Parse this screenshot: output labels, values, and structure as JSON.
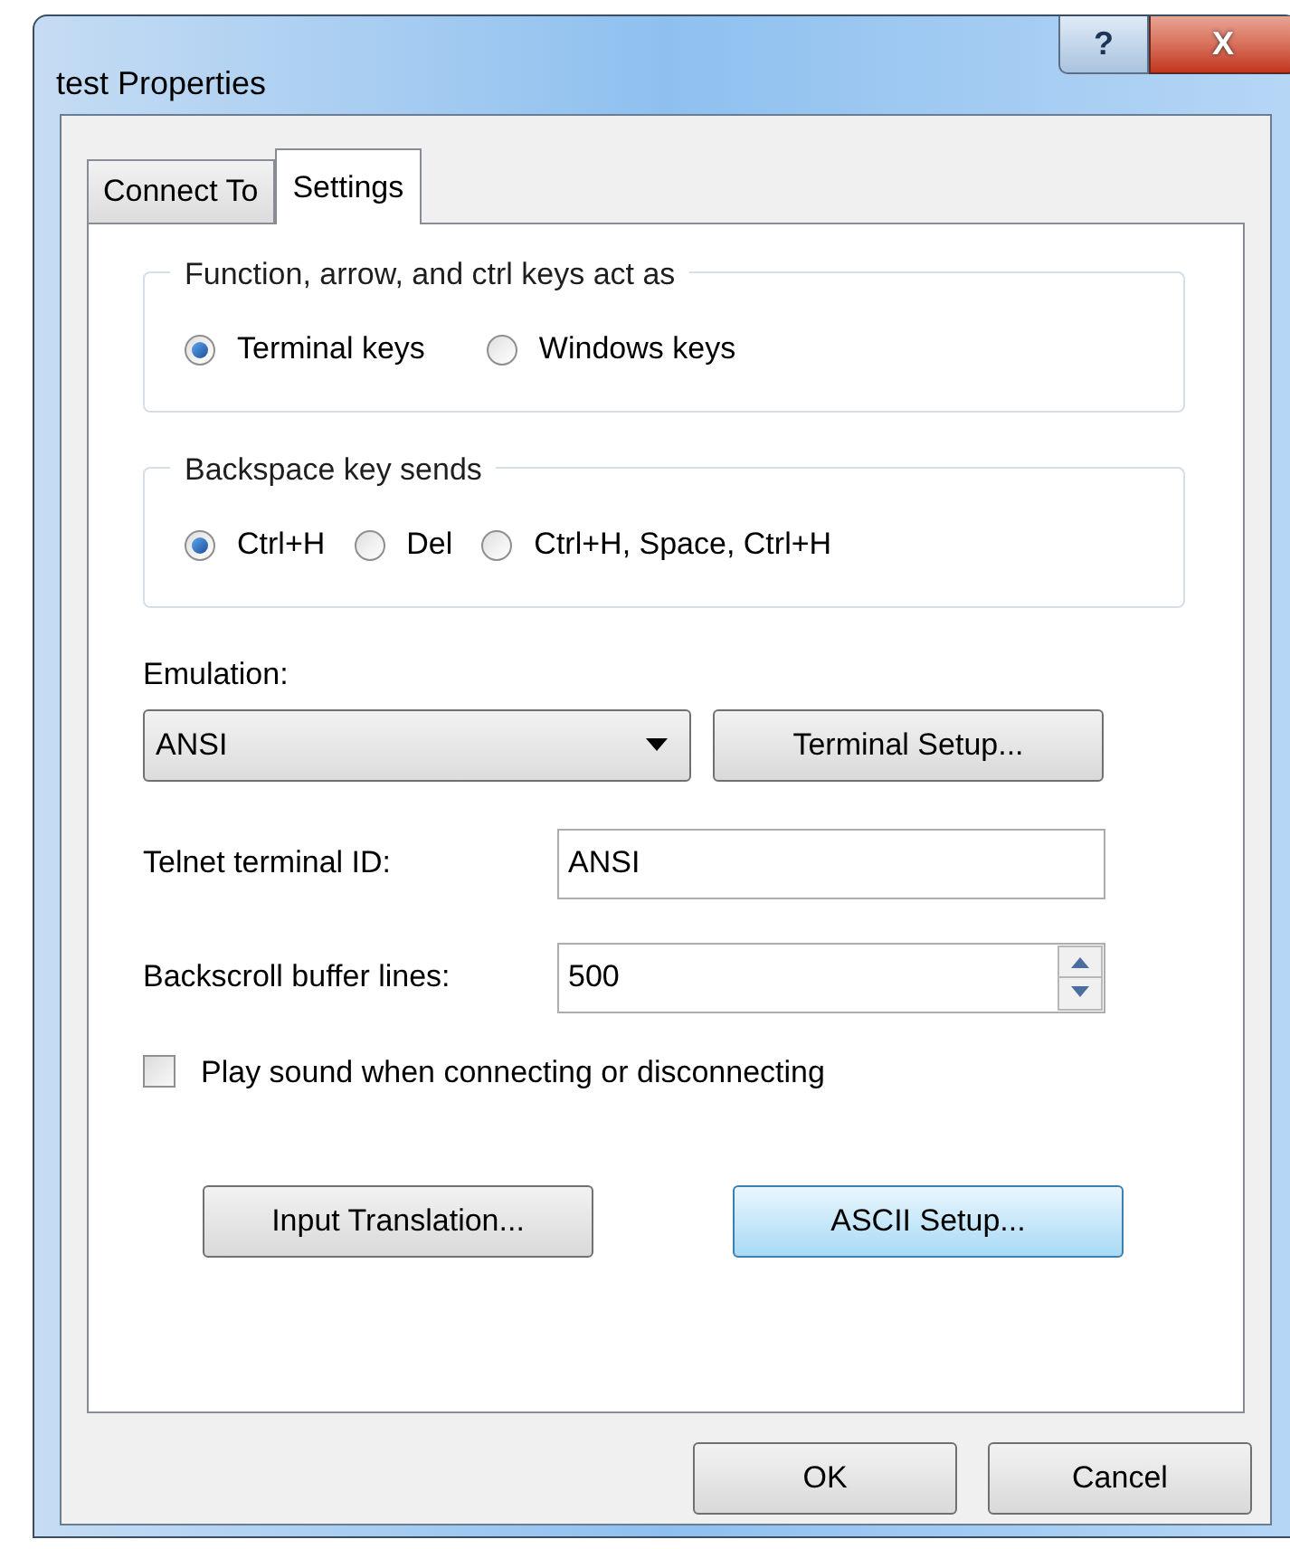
{
  "window": {
    "title": "test Properties",
    "help_button": "?",
    "close_button": "X"
  },
  "tabs": [
    {
      "label": "Connect To",
      "selected": false
    },
    {
      "label": "Settings",
      "selected": true
    }
  ],
  "groups": [
    {
      "legend": "Function, arrow, and ctrl keys act as",
      "options": [
        {
          "label": "Terminal keys",
          "selected": true
        },
        {
          "label": "Windows keys",
          "selected": false
        }
      ]
    },
    {
      "legend": "Backspace key sends",
      "options": [
        {
          "label": "Ctrl+H",
          "selected": true
        },
        {
          "label": "Del",
          "selected": false
        },
        {
          "label": "Ctrl+H, Space, Ctrl+H",
          "selected": false
        }
      ]
    }
  ],
  "emulation": {
    "label": "Emulation:",
    "value": "ANSI",
    "button": "Terminal Setup..."
  },
  "telnet_id": {
    "label": "Telnet terminal ID:",
    "value": "ANSI"
  },
  "backscroll": {
    "label": "Backscroll buffer lines:",
    "value": "500"
  },
  "play_sound": {
    "label": "Play sound when connecting or disconnecting",
    "checked": false
  },
  "panel_buttons": [
    {
      "label": "Input Translation...",
      "focused": false
    },
    {
      "label": "ASCII Setup...",
      "focused": true
    }
  ],
  "buttons": [
    "OK",
    "Cancel"
  ]
}
